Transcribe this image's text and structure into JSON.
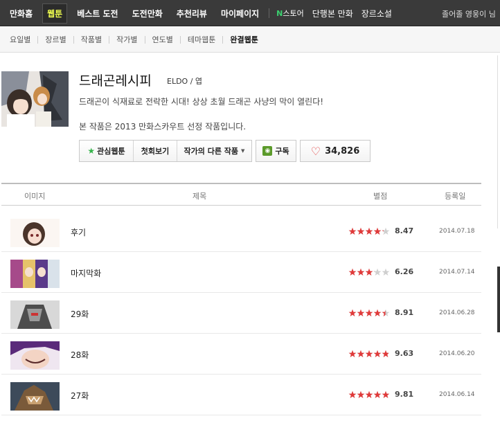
{
  "top_nav": {
    "items": [
      "만화홈",
      "웹툰",
      "베스트 도전",
      "도전만화",
      "추천리뷰",
      "마이페이지"
    ],
    "active_index": 1,
    "store_prefix": "N",
    "store_label": "스토어",
    "extra_links": [
      "단행본 만화",
      "장르소설"
    ],
    "user_text": "졸어졸 영웅이 님"
  },
  "sub_nav": {
    "items": [
      "요일별",
      "장르별",
      "작품별",
      "작가별",
      "연도별",
      "테마웹툰",
      "완결웹툰"
    ],
    "active_index": 6
  },
  "comic": {
    "title": "드래곤레시피",
    "author": "ELDO / 엽",
    "description": "드래곤이 식재료로 전락한 시대! 상상 초월 드래곤 사냥의 막이 열린다!",
    "note": "본 작품은 2013 만화스카우트 선정 작품입니다.",
    "buttons": {
      "favorite": "관심웹툰",
      "first_episode": "첫회보기",
      "other_works": "작가의 다른 작품",
      "subscribe": "구독",
      "likes": "34,826"
    }
  },
  "table": {
    "headers": {
      "image": "이미지",
      "title": "제목",
      "rating": "별점",
      "date": "등록일"
    },
    "rows": [
      {
        "episode": "후기",
        "score": "8.47",
        "rating": 8.47,
        "date": "2014.07.18"
      },
      {
        "episode": "마지막화",
        "score": "6.26",
        "rating": 6.26,
        "date": "2014.07.14"
      },
      {
        "episode": "29화",
        "score": "8.91",
        "rating": 8.91,
        "date": "2014.06.28"
      },
      {
        "episode": "28화",
        "score": "9.63",
        "rating": 9.63,
        "date": "2014.06.20"
      },
      {
        "episode": "27화",
        "score": "9.81",
        "rating": 9.81,
        "date": "2014.06.14"
      }
    ]
  },
  "colors": {
    "topbar": "#3a3a3a",
    "active_nav": "#f0ff4f",
    "star_red": "#e03a3a",
    "heart": "#e23b3b",
    "favorite_star": "#35b34a"
  }
}
